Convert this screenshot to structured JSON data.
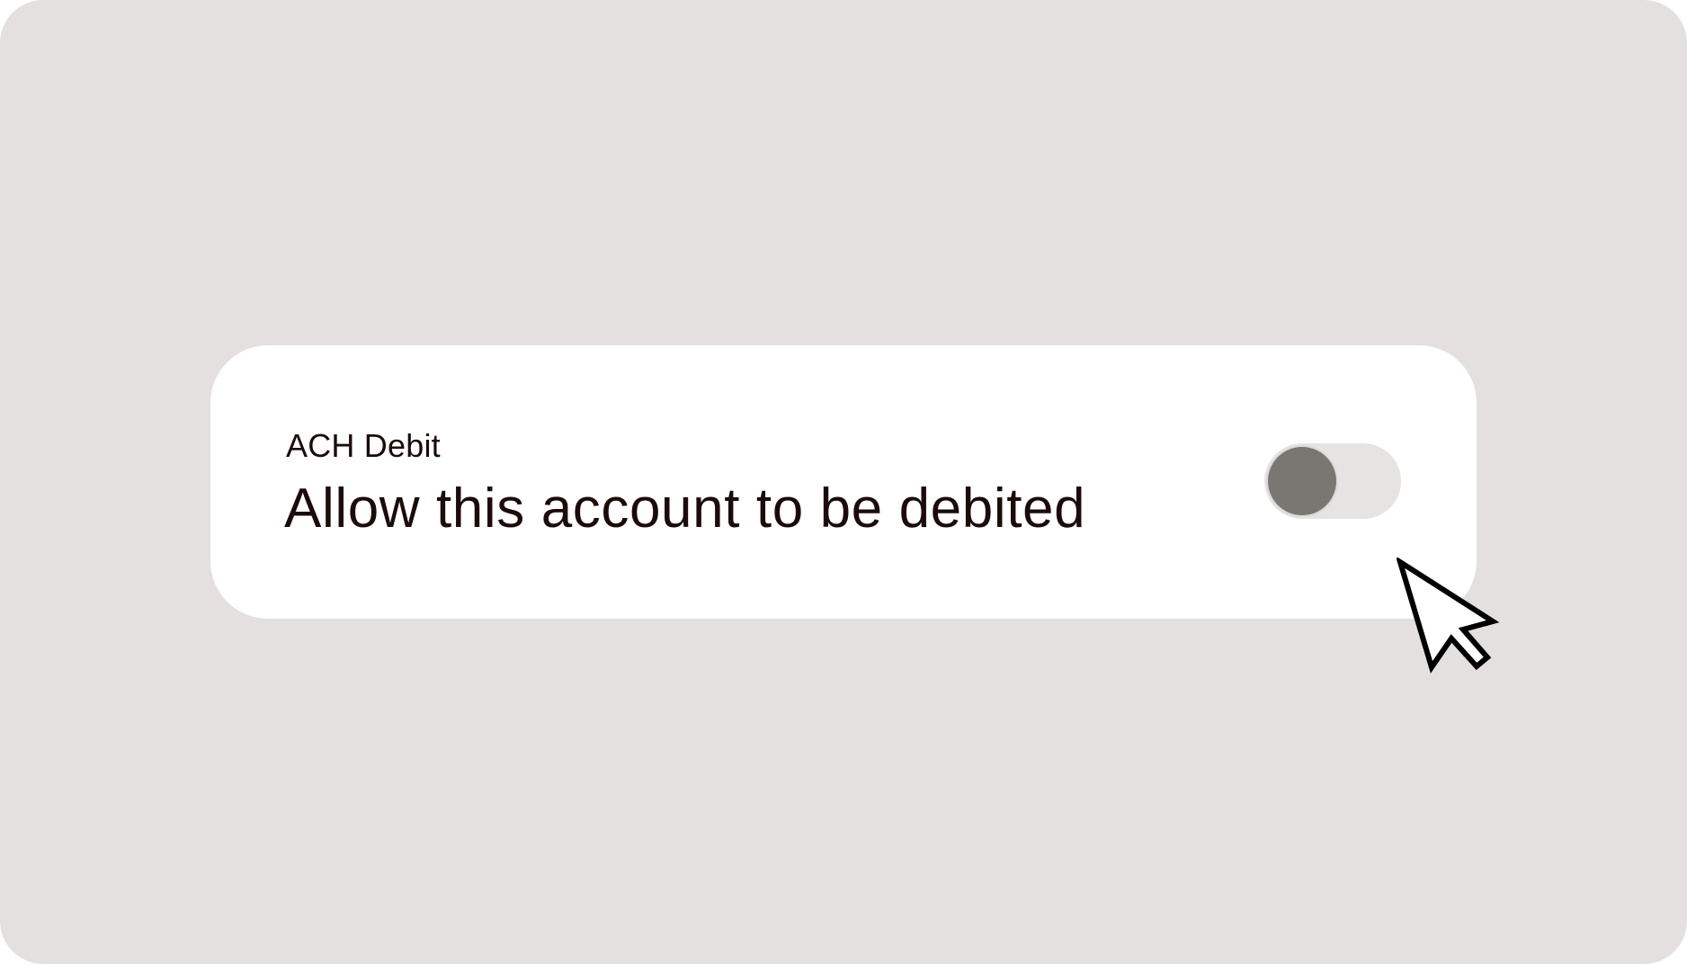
{
  "card": {
    "subtitle": "ACH Debit",
    "title": "Allow this account to be debited"
  },
  "toggle": {
    "state": "off",
    "knob_color": "#7a7772",
    "track_color": "#e6e4e3"
  },
  "cursor": {
    "icon": "arrow-pointer-icon"
  },
  "colors": {
    "background": "#e3e0df",
    "card": "#ffffff",
    "text": "#1c0b0b"
  }
}
